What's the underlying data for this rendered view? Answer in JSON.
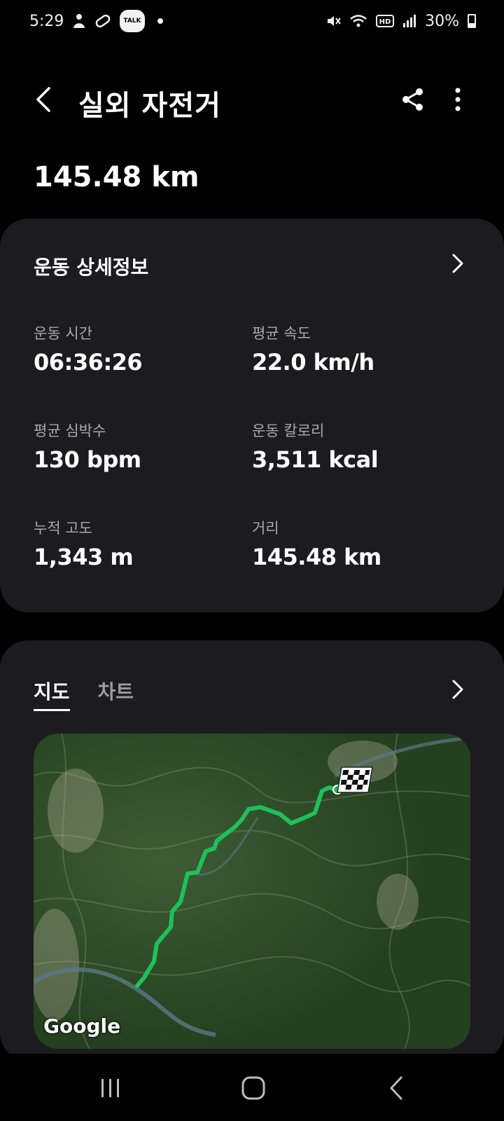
{
  "status": {
    "time": "5:29",
    "talk_label": "TALK",
    "battery": "30%",
    "battery_level": 0.3,
    "icons": [
      "person-icon",
      "pill-icon",
      "talk-icon",
      "dot-icon",
      "mute-icon",
      "wifi-icon",
      "hd-icon",
      "signal-icon",
      "battery-icon"
    ]
  },
  "header": {
    "title": "실외 자전거"
  },
  "summary": {
    "distance": "145.48 km"
  },
  "details": {
    "title": "운동 상세정보",
    "stats": [
      {
        "label": "운동 시간",
        "value": "06:36:26"
      },
      {
        "label": "평균 속도",
        "value": "22.0 km/h"
      },
      {
        "label": "평균 심박수",
        "value": "130 bpm"
      },
      {
        "label": "운동 칼로리",
        "value": "3,511 kcal"
      },
      {
        "label": "누적 고도",
        "value": "1,343 m"
      },
      {
        "label": "거리",
        "value": "145.48 km"
      }
    ]
  },
  "map_section": {
    "tabs": [
      {
        "label": "지도",
        "active": true
      },
      {
        "label": "차트",
        "active": false
      }
    ],
    "map_attribution": "Google",
    "route_color": "#1ec05a"
  }
}
